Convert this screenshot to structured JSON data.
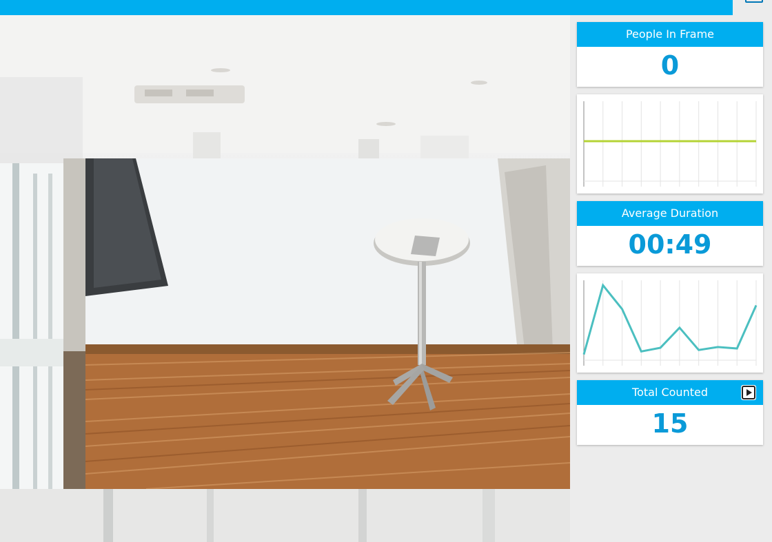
{
  "colors": {
    "accent": "#00aeef",
    "value_text": "#0a9ad8",
    "chart1_line": "#b5d335",
    "chart2_line": "#4bbfc0"
  },
  "icons": {
    "corner": "window-icon",
    "total_counted_action": "play-icon"
  },
  "video": {
    "background_scene": "office-interior",
    "frame_scene": "room-with-standing-table"
  },
  "metrics": {
    "people_in_frame": {
      "label": "People In Frame",
      "value": "0"
    },
    "average_duration": {
      "label": "Average Duration",
      "value": "00:49"
    },
    "total_counted": {
      "label": "Total Counted",
      "value": "15"
    }
  },
  "chart_data": [
    {
      "type": "line",
      "series": [
        {
          "values": [
            0.5,
            0.5,
            0.5,
            0.5,
            0.5,
            0.5,
            0.5,
            0.5,
            0.5,
            0.5
          ]
        }
      ],
      "ylim": [
        0,
        1
      ],
      "grid": true
    },
    {
      "type": "line",
      "series": [
        {
          "values": [
            0.04,
            0.97,
            0.65,
            0.08,
            0.13,
            0.4,
            0.1,
            0.14,
            0.12,
            0.7
          ]
        }
      ],
      "ylim": [
        0,
        1
      ],
      "grid": true
    }
  ]
}
